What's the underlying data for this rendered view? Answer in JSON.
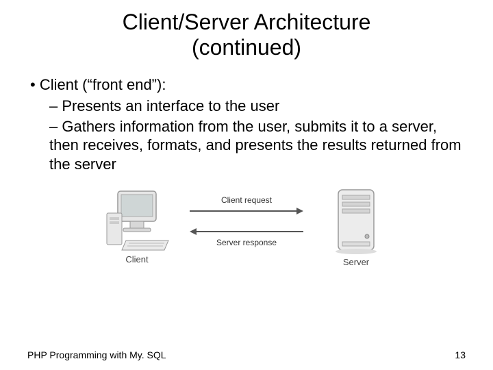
{
  "title_line1": "Client/Server Architecture",
  "title_line2": "(continued)",
  "bullet1": "Client (“front end”):",
  "bullet1a": "Presents an interface to the user",
  "bullet1b": "Gathers information from the user, submits it to a server, then receives, formats, and presents the results returned from the server",
  "diagram": {
    "client_label": "Client",
    "server_label": "Server",
    "request_label": "Client request",
    "response_label": "Server response"
  },
  "footer_left": "PHP Programming with My. SQL",
  "footer_right": "13"
}
